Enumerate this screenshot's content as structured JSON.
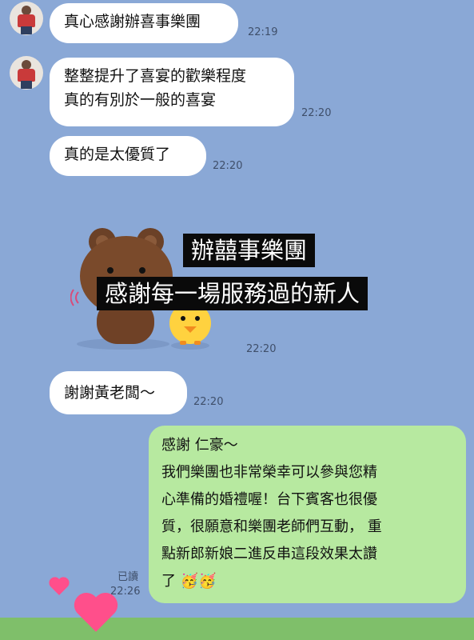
{
  "messages": [
    {
      "text": [
        "真心感謝辦喜事樂團"
      ],
      "time": "22:19"
    },
    {
      "text": [
        "整整提升了喜宴的歡樂程度",
        "真的有別於一般的喜宴"
      ],
      "time": "22:20"
    },
    {
      "text": [
        "真的是太優質了"
      ],
      "time": "22:20"
    },
    {
      "sticker_caption": [
        "辦囍事樂團",
        "感謝每一場服務過的新人"
      ],
      "time": "22:20"
    },
    {
      "text": [
        "謝謝黃老闆～"
      ],
      "time": "22:20"
    }
  ],
  "reply": {
    "lines": [
      "感謝 仁豪～",
      "我們樂團也非常榮幸可以參與您精",
      "心準備的婚禮喔！台下賓客也很優",
      "質，很願意和樂團老師們互動， 重",
      "點新郎新娘二進反串這段效果太讚",
      "了 🥳🥳"
    ],
    "read_label": "已讀",
    "time": "22:26"
  },
  "colors": {
    "background": "#8aa8d6",
    "bubble_incoming": "#ffffff",
    "bubble_outgoing": "#b7e9a0"
  },
  "icons": [
    "avatar-photo",
    "brown-bear-sticker",
    "sally-chick-sticker",
    "heart-icon"
  ]
}
